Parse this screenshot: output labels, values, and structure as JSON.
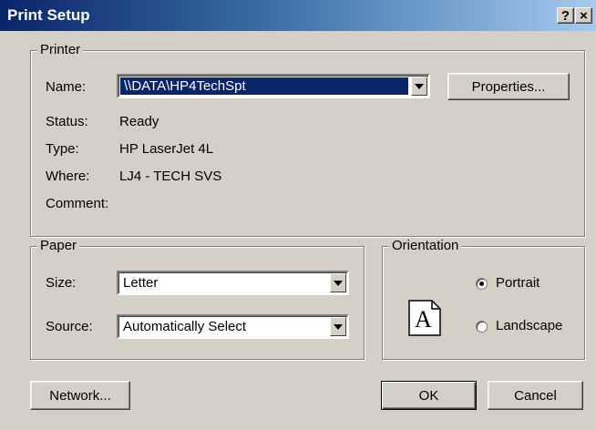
{
  "window": {
    "title": "Print Setup",
    "help_button": "?",
    "close_button": "×"
  },
  "printer": {
    "group_label": "Printer",
    "name_label": "Name:",
    "name_value": "\\\\DATA\\HP4TechSpt",
    "properties_button": "Properties...",
    "status_label": "Status:",
    "status_value": "Ready",
    "type_label": "Type:",
    "type_value": "HP LaserJet 4L",
    "where_label": "Where:",
    "where_value": "LJ4 - TECH SVS",
    "comment_label": "Comment:",
    "comment_value": ""
  },
  "paper": {
    "group_label": "Paper",
    "size_label": "Size:",
    "size_value": "Letter",
    "source_label": "Source:",
    "source_value": "Automatically Select"
  },
  "orientation": {
    "group_label": "Orientation",
    "page_icon_letter": "A",
    "portrait_label": "Portrait",
    "landscape_label": "Landscape",
    "selected": "Portrait"
  },
  "buttons": {
    "network": "Network...",
    "ok": "OK",
    "cancel": "Cancel"
  },
  "icons": {
    "page_icon": "portrait-page-icon",
    "dropdown_icon": "chevron-down-icon"
  }
}
